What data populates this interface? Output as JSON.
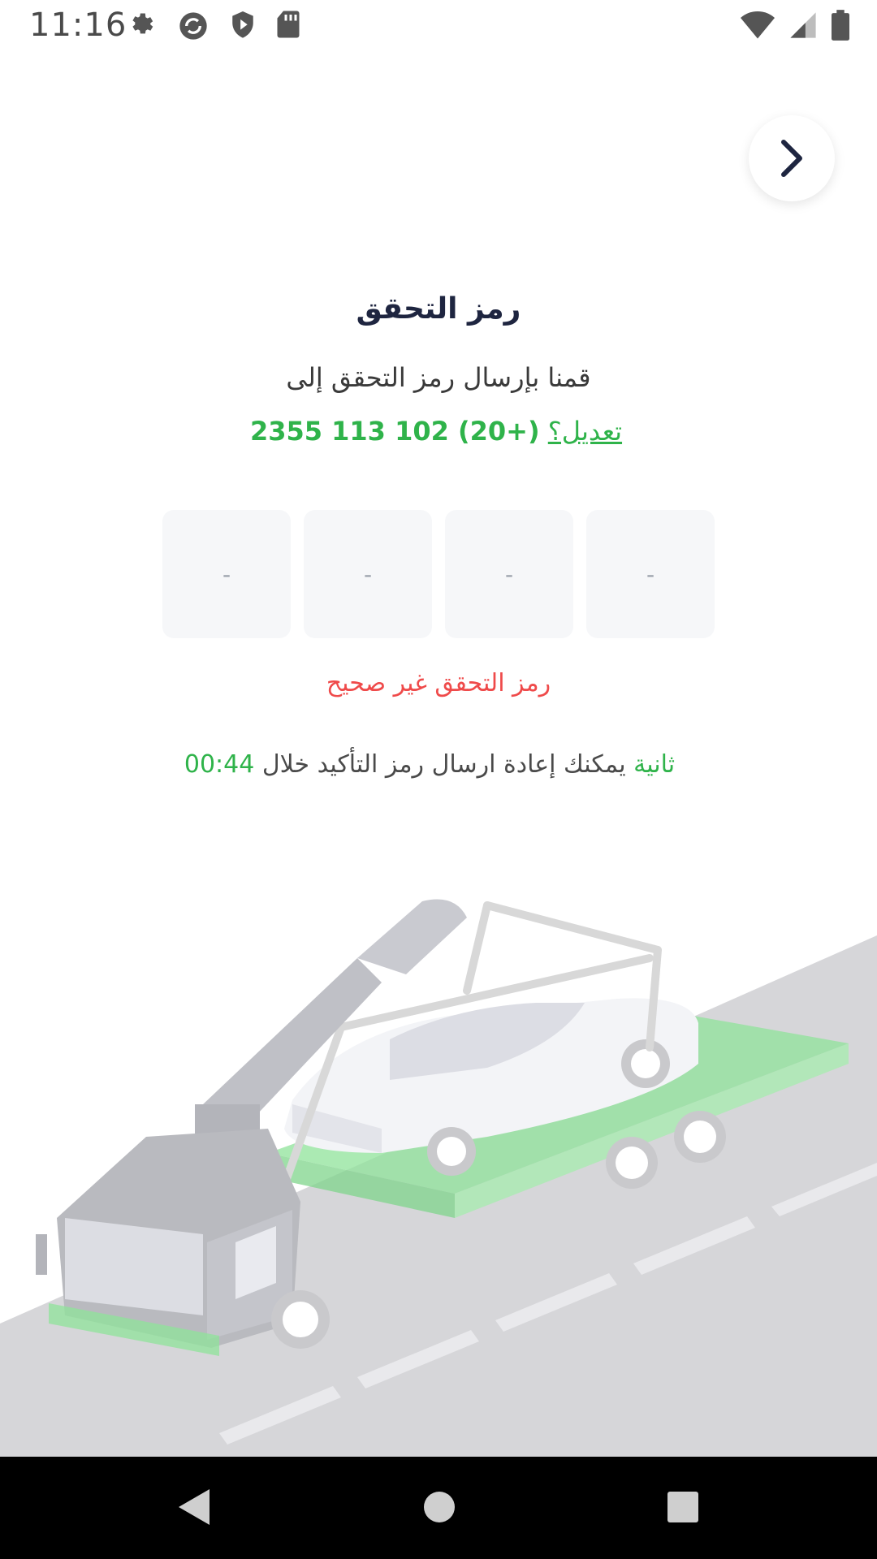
{
  "status_bar": {
    "time": "11:16",
    "left_icons": [
      "settings-icon",
      "sync-icon",
      "shield-play-icon",
      "sd-card-icon"
    ],
    "right_icons": [
      "wifi-icon",
      "signal-icon",
      "battery-icon"
    ]
  },
  "header": {
    "back_icon": "chevron-right-icon"
  },
  "verification": {
    "title": "رمز التحقق",
    "subtitle": "قمنا بإرسال رمز التحقق إلى",
    "phone_number": "(+20) 102 113 2355",
    "edit_link": "تعديل؟",
    "otp_digits": [
      "-",
      "-",
      "-",
      "-"
    ],
    "error_message": "رمز التحقق غير صحيح",
    "resend_label": "يمكنك إعادة ارسال رمز التأكيد خلال",
    "resend_timer": "00:44 ثانية"
  },
  "illustration": {
    "subject": "tow-truck-illustration"
  },
  "colors": {
    "accent_green": "#2fb34a",
    "error_red": "#ef4a4a",
    "title_navy": "#1e2540",
    "otp_box_bg": "#f6f7f9"
  },
  "nav_bar": {
    "icons": [
      "back-triangle-icon",
      "home-circle-icon",
      "recents-square-icon"
    ]
  }
}
